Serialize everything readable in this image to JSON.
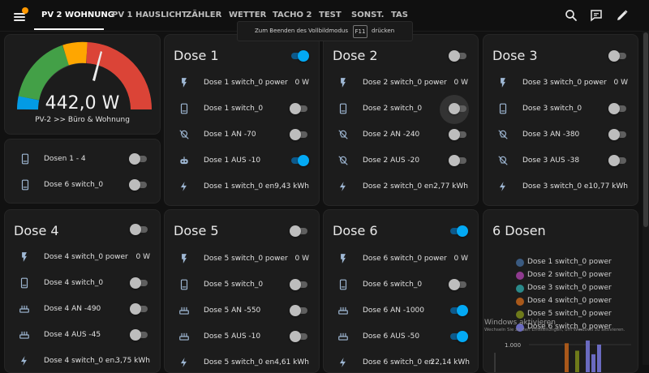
{
  "header": {
    "tabs": [
      {
        "label": "PV 2 WOHNUNG",
        "active": true
      },
      {
        "label": "PV 1 HAUSLICHT"
      },
      {
        "label": "ZÄHLER"
      },
      {
        "label": "WETTER"
      },
      {
        "label": "TACHO 2"
      },
      {
        "label": "TEST"
      },
      {
        "label": "SONST."
      },
      {
        "label": "TAS"
      }
    ],
    "icons": [
      "menu-icon",
      "search-icon",
      "assist-icon",
      "edit-pencil-icon"
    ],
    "notification_color": "#ff9800"
  },
  "fullscreen_toast": {
    "text_before": "Zum Beenden des Vollbildmodus",
    "key": "F11",
    "text_after": "drücken"
  },
  "gauge": {
    "value": "442,0 W",
    "name": "PV-2 >> Büro & Wohnung",
    "segments": [
      "#039be5",
      "#43a047",
      "#ffa600",
      "#db4437"
    ]
  },
  "small_switches": {
    "rows": [
      {
        "label": "Dosen 1 - 4",
        "on": false,
        "icon": "phone-device-icon"
      },
      {
        "label": "Dose 6 switch_0",
        "on": false,
        "icon": "phone-device-icon"
      }
    ]
  },
  "cards": {
    "dose1": {
      "title": "Dose 1",
      "on": true,
      "rows": [
        {
          "label": "Dose 1 switch_0 power",
          "value": "0 W",
          "icon": "flash-icon"
        },
        {
          "label": "Dose 1 switch_0",
          "on": false,
          "icon": "phone-device-icon"
        },
        {
          "label": "Dose 1 AN -70",
          "on": false,
          "icon": "lightbulb-off-icon"
        },
        {
          "label": "Dose 1 AUS -10",
          "on": true,
          "icon": "robot-icon"
        },
        {
          "label": "Dose 1 switch_0 en...",
          "value": "9,43 kWh",
          "icon": "bolt-icon"
        }
      ]
    },
    "dose2": {
      "title": "Dose 2",
      "on": false,
      "rows": [
        {
          "label": "Dose 2 switch_0 power",
          "value": "0 W",
          "icon": "flash-icon"
        },
        {
          "label": "Dose 2 switch_0",
          "on": false,
          "icon": "phone-device-icon"
        },
        {
          "label": "Dose 2 AN -240",
          "on": false,
          "icon": "lightbulb-off-icon"
        },
        {
          "label": "Dose 2 AUS -20",
          "on": false,
          "icon": "lightbulb-off-icon"
        },
        {
          "label": "Dose 2 switch_0 en...",
          "value": "2,77 kWh",
          "icon": "bolt-icon"
        }
      ]
    },
    "dose3": {
      "title": "Dose 3",
      "on": false,
      "rows": [
        {
          "label": "Dose 3 switch_0 power",
          "value": "0 W",
          "icon": "flash-icon"
        },
        {
          "label": "Dose 3 switch_0",
          "on": false,
          "icon": "phone-device-icon"
        },
        {
          "label": "Dose 3 AN -380",
          "on": false,
          "icon": "lightbulb-off-icon"
        },
        {
          "label": "Dose 3 AUS -38",
          "on": false,
          "icon": "lightbulb-off-icon"
        },
        {
          "label": "Dose 3 switch_0 e...",
          "value": "10,77 kWh",
          "icon": "bolt-icon"
        }
      ]
    },
    "dose4": {
      "title": "Dose 4",
      "on": false,
      "rows": [
        {
          "label": "Dose 4 switch_0 power",
          "value": "0 W",
          "icon": "flash-icon"
        },
        {
          "label": "Dose 4 switch_0",
          "on": false,
          "icon": "phone-device-icon"
        },
        {
          "label": "Dose 4 AN -490",
          "on": false,
          "icon": "router-icon"
        },
        {
          "label": "Dose 4 AUS -45",
          "on": false,
          "icon": "router-icon"
        },
        {
          "label": "Dose 4 switch_0 en...",
          "value": "3,75 kWh",
          "icon": "bolt-icon"
        }
      ]
    },
    "dose5": {
      "title": "Dose 5",
      "on": false,
      "rows": [
        {
          "label": "Dose 5 switch_0 power",
          "value": "0 W",
          "icon": "flash-icon"
        },
        {
          "label": "Dose 5 switch_0",
          "on": false,
          "icon": "phone-device-icon"
        },
        {
          "label": "Dose 5 AN -550",
          "on": false,
          "icon": "router-icon"
        },
        {
          "label": "Dose 5 AUS -10",
          "on": false,
          "icon": "router-icon"
        },
        {
          "label": "Dose 5 switch_0 en...",
          "value": "4,61 kWh",
          "icon": "bolt-icon"
        }
      ]
    },
    "dose6": {
      "title": "Dose 6",
      "on": true,
      "rows": [
        {
          "label": "Dose 6 switch_0 power",
          "value": "0 W",
          "icon": "flash-icon"
        },
        {
          "label": "Dose 6 switch_0",
          "on": false,
          "icon": "phone-device-icon"
        },
        {
          "label": "Dose 6 AN -1000",
          "on": true,
          "icon": "router-icon"
        },
        {
          "label": "Dose 6 AUS -50",
          "on": true,
          "icon": "router-icon"
        },
        {
          "label": "Dose 6 switch_0 en...",
          "value": "22,14 kWh",
          "icon": "bolt-icon"
        }
      ]
    }
  },
  "chart_card": {
    "title": "6 Dosen",
    "legend": [
      {
        "label": "Dose 1 switch_0 power",
        "color": "#3a5a80"
      },
      {
        "label": "Dose 2 switch_0 power",
        "color": "#8e3a8e"
      },
      {
        "label": "Dose 3 switch_0 power",
        "color": "#2a8a8a"
      },
      {
        "label": "Dose 4 switch_0 power",
        "color": "#a8581a"
      },
      {
        "label": "Dose 5 switch_0 power",
        "color": "#6e7a1a"
      },
      {
        "label": "Dose 6 switch_0 power",
        "color": "#6a6ac0"
      }
    ],
    "ytick": "1.000"
  },
  "chart_data": {
    "type": "bar",
    "title": "6 Dosen",
    "series": [
      {
        "name": "Dose 1 switch_0 power",
        "values": [
          0
        ]
      },
      {
        "name": "Dose 2 switch_0 power",
        "values": [
          0
        ]
      },
      {
        "name": "Dose 3 switch_0 power",
        "values": [
          0
        ]
      },
      {
        "name": "Dose 4 switch_0 power",
        "values": [
          1050,
          0
        ]
      },
      {
        "name": "Dose 5 switch_0 power",
        "values": [
          0,
          780
        ]
      },
      {
        "name": "Dose 6 switch_0 power",
        "values": [
          1150,
          650,
          1000
        ]
      }
    ],
    "yticks": [
      "1.000"
    ],
    "legend_position": "top"
  },
  "watermark": {
    "line1": "Windows aktivieren",
    "line2": "Wechseln Sie zu den Einstellungen, um Windows zu aktivieren."
  }
}
